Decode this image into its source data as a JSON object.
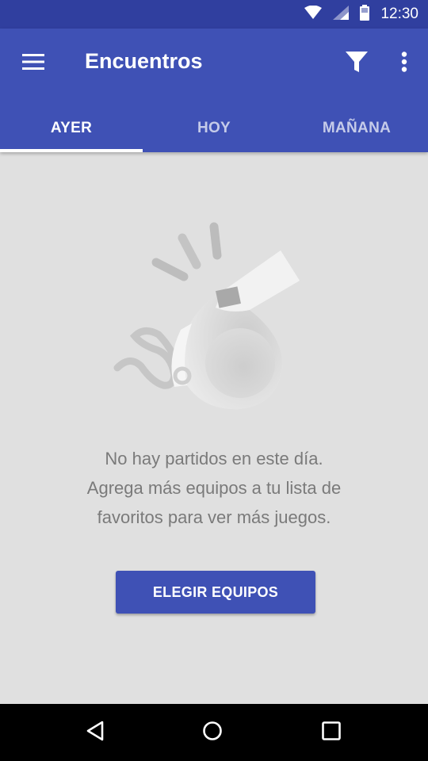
{
  "status_bar": {
    "time": "12:30",
    "icons": [
      "wifi-icon",
      "cell-signal-icon",
      "battery-icon"
    ]
  },
  "app_bar": {
    "title": "Encuentros",
    "menu_icon": "hamburger-menu-icon",
    "filter_icon": "filter-icon",
    "more_icon": "more-vert-icon"
  },
  "tabs": [
    {
      "label": "AYER",
      "active": true
    },
    {
      "label": "HOY",
      "active": false
    },
    {
      "label": "MAÑANA",
      "active": false
    }
  ],
  "empty_state": {
    "illustration": "whistle-illustration",
    "lines": [
      "No hay partidos en este día.",
      "Agrega más equipos a tu lista de",
      "favoritos para ver más juegos."
    ],
    "button_label": "ELEGIR EQUIPOS"
  },
  "nav_bar": {
    "icons": [
      "back-icon",
      "home-icon",
      "recents-icon"
    ]
  },
  "colors": {
    "primary": "#3f51b5",
    "primary_dark": "#303f9f",
    "background": "#e0e0e0",
    "text_secondary": "#7a7a7a"
  }
}
